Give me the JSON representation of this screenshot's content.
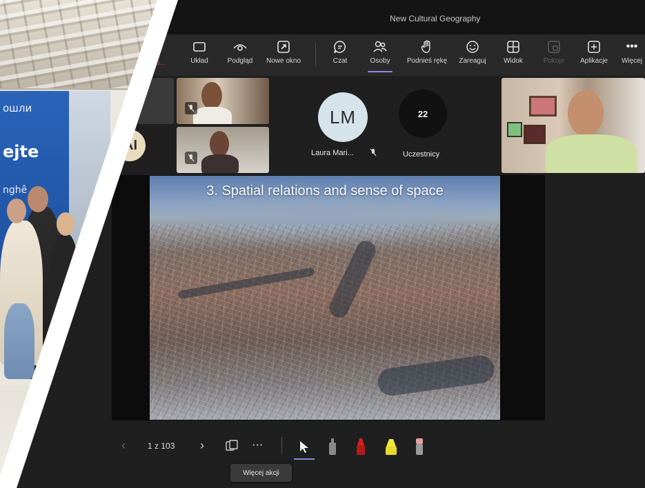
{
  "photo": {
    "banner_line1": "ошли",
    "banner_line2": "ejte",
    "banner_line3": "nghê"
  },
  "window": {
    "title": "New Cultural Geography"
  },
  "ribbon": {
    "fragment": "u...",
    "items": [
      {
        "label": "Układ",
        "icon": "layout-icon"
      },
      {
        "label": "Podgląd",
        "icon": "eye-icon"
      },
      {
        "label": "Nowe okno",
        "icon": "pop-out-icon"
      },
      {
        "label": "Czat",
        "icon": "chat-icon"
      },
      {
        "label": "Osoby",
        "icon": "people-icon"
      },
      {
        "label": "Podnieś rękę",
        "icon": "raise-hand-icon"
      },
      {
        "label": "Zareaguj",
        "icon": "smiley-icon"
      },
      {
        "label": "Widok",
        "icon": "grid-icon"
      },
      {
        "label": "Pokoje",
        "icon": "rooms-icon"
      },
      {
        "label": "Aplikacje",
        "icon": "plus-box-icon"
      },
      {
        "label": "Więcej",
        "icon": "more-icon"
      }
    ],
    "active": "Osoby",
    "disabled": "Pokoje"
  },
  "participants": {
    "initials": "LM",
    "name": "Laura Mari...",
    "ai_initials": "AI",
    "count": "22",
    "count_label": "Uczestnicy"
  },
  "slide": {
    "title": "3. Spatial relations and sense of space"
  },
  "controls": {
    "page": "1 z 103",
    "more_tooltip": "Więcej akcji"
  },
  "colors": {
    "accent": "#8f8ae6",
    "background": "#1f1f1f",
    "ribbon": "#292929"
  }
}
